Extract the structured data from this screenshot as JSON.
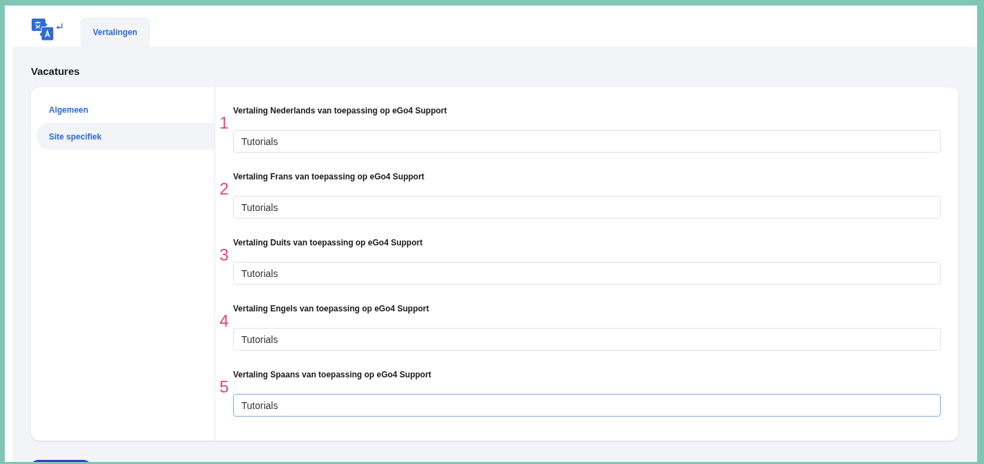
{
  "tabs": [
    {
      "label": "Vertalingen",
      "selected": true
    }
  ],
  "page_title": "Vacatures",
  "sidebar": {
    "items": [
      {
        "label": "Algemeen",
        "selected": false
      },
      {
        "label": "Site specifiek",
        "selected": true
      }
    ]
  },
  "fields": [
    {
      "marker": "1",
      "label": "Vertaling Nederlands van toepassing op eGo4 Support",
      "value": "Tutorials",
      "focused": false
    },
    {
      "marker": "2",
      "label": "Vertaling Frans van toepassing op eGo4 Support",
      "value": "Tutorials",
      "focused": false
    },
    {
      "marker": "3",
      "label": "Vertaling Duits van toepassing op eGo4 Support",
      "value": "Tutorials",
      "focused": false
    },
    {
      "marker": "4",
      "label": "Vertaling Engels van toepassing op eGo4 Support",
      "value": "Tutorials",
      "focused": false
    },
    {
      "marker": "5",
      "label": "Vertaling Spaans van toepassing op eGo4 Support",
      "value": "Tutorials",
      "focused": true
    }
  ]
}
